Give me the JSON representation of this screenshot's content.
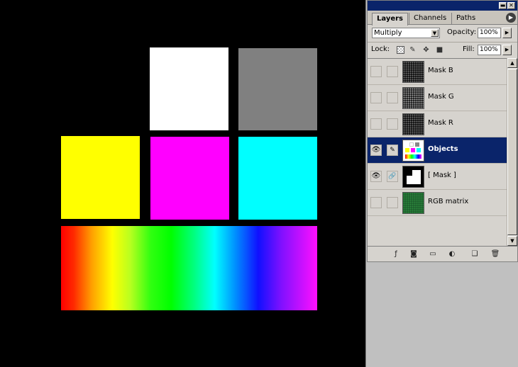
{
  "panel": {
    "tabs": [
      {
        "label": "Layers",
        "active": true
      },
      {
        "label": "Channels",
        "active": false
      },
      {
        "label": "Paths",
        "active": false
      }
    ],
    "blend_mode": "Multiply",
    "opacity_label": "Opacity:",
    "opacity_value": "100%",
    "lock_label": "Lock:",
    "fill_label": "Fill:",
    "fill_value": "100%",
    "layers": [
      {
        "name": "Mask B",
        "visible": false,
        "linked": false,
        "active": false
      },
      {
        "name": "Mask G",
        "visible": false,
        "linked": false,
        "active": false
      },
      {
        "name": "Mask R",
        "visible": false,
        "linked": false,
        "active": false
      },
      {
        "name": "Objects",
        "visible": true,
        "linked": false,
        "active": true
      },
      {
        "name": "[ Mask ]",
        "visible": true,
        "linked": true,
        "active": false
      },
      {
        "name": "RGB matrix",
        "visible": false,
        "linked": false,
        "active": false
      }
    ]
  },
  "canvas": {
    "background": "#000000",
    "swatch_colors": {
      "white": "#ffffff",
      "gray": "#808080",
      "yellow": "#ffff00",
      "magenta": "#ff00ff",
      "cyan": "#00ffff"
    }
  },
  "icons": {
    "eye": "eye-icon",
    "brush": "brush-icon",
    "chain": "link-icon",
    "menu": "panel-menu-arrow-icon"
  }
}
